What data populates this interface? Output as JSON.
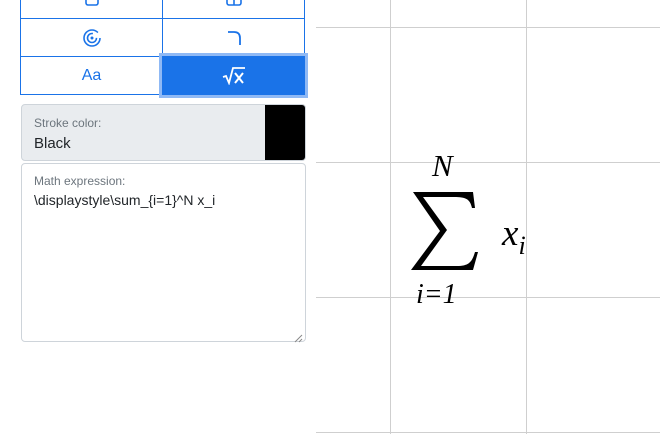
{
  "tools": {
    "aa_label": "Aa"
  },
  "stroke": {
    "label": "Stroke color:",
    "value": "Black",
    "swatch_color": "#000000"
  },
  "math": {
    "label": "Math expression:",
    "value": "\\displaystyle\\sum_{i=1}^N x_i"
  },
  "formula": {
    "upper": "N",
    "lower": "i=1",
    "term": "x",
    "term_sub": "i"
  },
  "colors": {
    "accent": "#1a73e8",
    "active_ring": "#8fb9f5",
    "panel_bg": "#e9ecef",
    "grid_line": "#cfcfcf"
  },
  "icons": [
    "rectangle-icon",
    "table-icon",
    "spiral-icon",
    "curve-icon",
    "text-icon",
    "sqrt-icon"
  ]
}
